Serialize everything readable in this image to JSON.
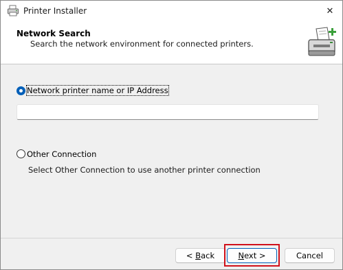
{
  "window": {
    "title": "Printer Installer",
    "close_label": "✕"
  },
  "header": {
    "title": "Network Search",
    "subtitle": "Search the network environment for connected printers."
  },
  "options": {
    "network": {
      "label": "Network printer name or IP Address",
      "checked": true,
      "input_value": ""
    },
    "other": {
      "label": "Other Connection",
      "checked": false,
      "description": "Select Other Connection to use another printer connection"
    }
  },
  "buttons": {
    "back": {
      "prefix": "< ",
      "accel": "B",
      "rest": "ack"
    },
    "next": {
      "accel": "N",
      "rest": "ext >"
    },
    "cancel": {
      "label": "Cancel"
    }
  },
  "icons": [
    "printer-app-icon",
    "close-icon",
    "printer-add-icon"
  ],
  "colors": {
    "accent": "#005fb8",
    "highlight": "#d0101a",
    "add_plus": "#3aa03a"
  }
}
